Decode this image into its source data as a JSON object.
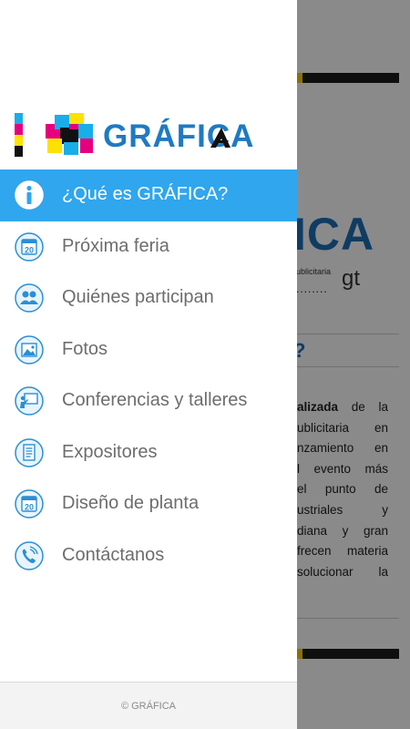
{
  "background": {
    "logo_text": "ICA",
    "tagline": "ublicitaria",
    "domain_suffix": "gt",
    "dots": "........",
    "section_mark": "?",
    "paragraph_lines": [
      "alizada de la",
      "ublicitaria en",
      "nzamiento en",
      "l evento más",
      "el punto de",
      "ustriales y",
      "diana y gran",
      "frecen materia",
      "solucionar la"
    ],
    "bold_word": "alizada"
  },
  "drawer": {
    "brand": "GRÁFICA",
    "brand_colors": {
      "cyan": "#19aee8",
      "magenta": "#e6007e",
      "yellow": "#ffe100",
      "black": "#111111"
    },
    "menu": [
      {
        "label": "¿Qué es GRÁFICA?",
        "icon": "info-icon",
        "active": true
      },
      {
        "label": "Próxima feria",
        "icon": "calendar-20-icon",
        "active": false
      },
      {
        "label": "Quiénes participan",
        "icon": "people-icon",
        "active": false
      },
      {
        "label": "Fotos",
        "icon": "photo-icon",
        "active": false
      },
      {
        "label": "Conferencias y talleres",
        "icon": "presentation-icon",
        "active": false
      },
      {
        "label": "Expositores",
        "icon": "document-icon",
        "active": false
      },
      {
        "label": "Diseño de planta",
        "icon": "calendar-20-icon",
        "active": false
      },
      {
        "label": "Contáctanos",
        "icon": "phone-icon",
        "active": false
      }
    ],
    "calendar_number": "20",
    "footer": "© GRÁFICA"
  },
  "accent_color": "#2fa6ee"
}
